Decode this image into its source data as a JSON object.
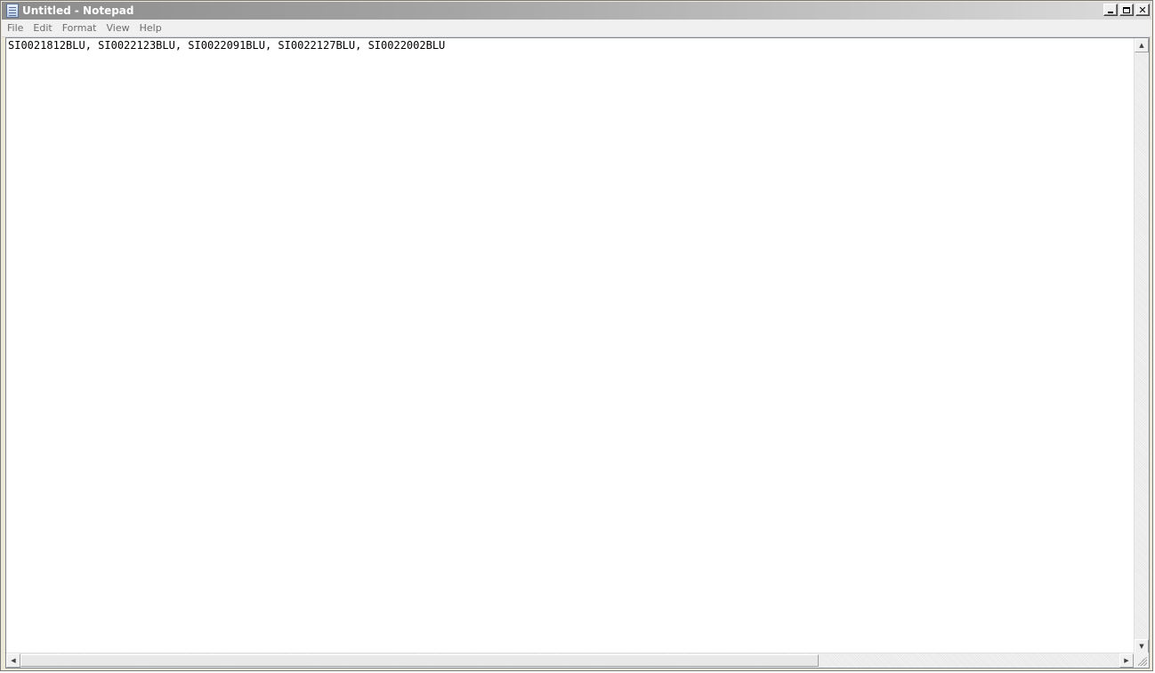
{
  "window": {
    "title": "Untitled - Notepad",
    "controls": {
      "minimize": "",
      "maximize": "",
      "close": "✕"
    }
  },
  "menu": {
    "items": [
      {
        "label": "File"
      },
      {
        "label": "Edit"
      },
      {
        "label": "Format"
      },
      {
        "label": "View"
      },
      {
        "label": "Help"
      }
    ]
  },
  "editor": {
    "content": "SI0021812BLU, SI0022123BLU, SI0022091BLU, SI0022127BLU, SI0022002BLU"
  },
  "scrollbars": {
    "up_arrow": "▲",
    "down_arrow": "▼",
    "left_arrow": "◀",
    "right_arrow": "▶"
  },
  "colors": {
    "titlebar_start": "#8c8c8c",
    "titlebar_end": "#dcdcdc",
    "menu_text": "#6d6d6d"
  }
}
